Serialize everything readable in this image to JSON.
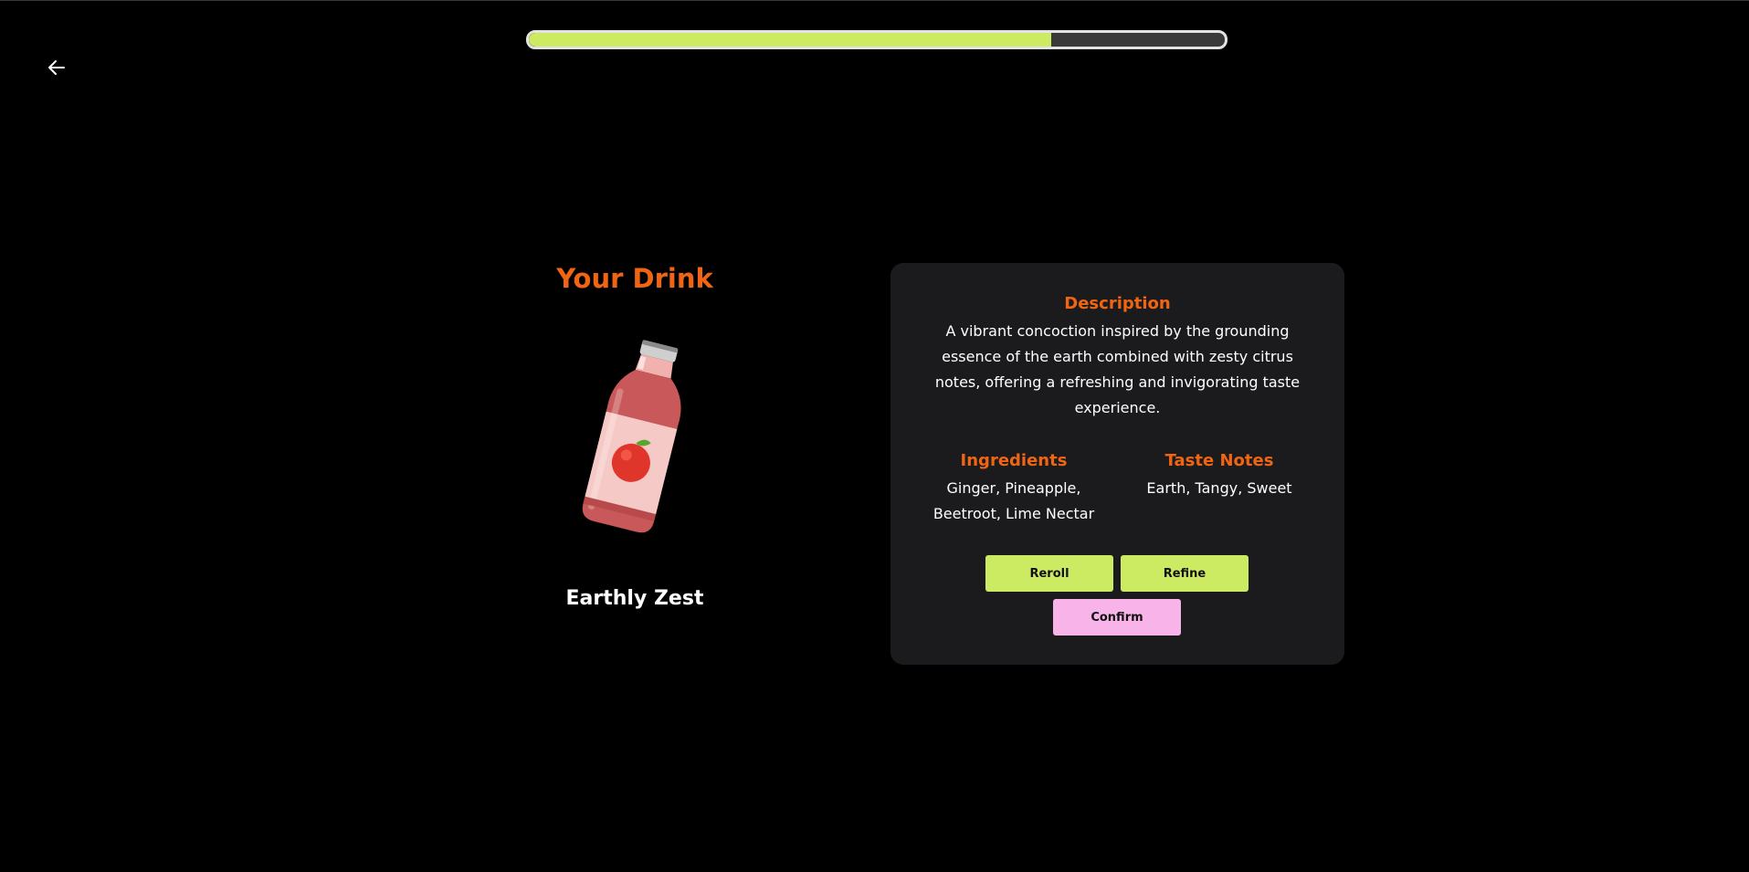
{
  "progress": {
    "value": 0.75,
    "fill_color": "#cdea63",
    "track_color": "#3a3a3a"
  },
  "nav": {
    "back_icon": "arrow-left-icon"
  },
  "drink": {
    "heading": "Your Drink",
    "name": "Earthly Zest",
    "image_icon": "juice-bottle-icon"
  },
  "details": {
    "description_title": "Description",
    "description": "A vibrant concoction inspired by the grounding essence of the earth combined with zesty citrus notes, offering a refreshing and invigorating taste experience.",
    "ingredients_title": "Ingredients",
    "ingredients": "Ginger, Pineapple, Beetroot, Lime Nectar",
    "taste_title": "Taste Notes",
    "taste_notes": "Earth, Tangy, Sweet"
  },
  "actions": {
    "reroll_label": "Reroll",
    "refine_label": "Refine",
    "confirm_label": "Confirm"
  },
  "colors": {
    "accent": "#f06514",
    "primary_button": "#cdea63",
    "confirm_button": "#f8b3e8",
    "card_background": "#1b1b1d"
  }
}
